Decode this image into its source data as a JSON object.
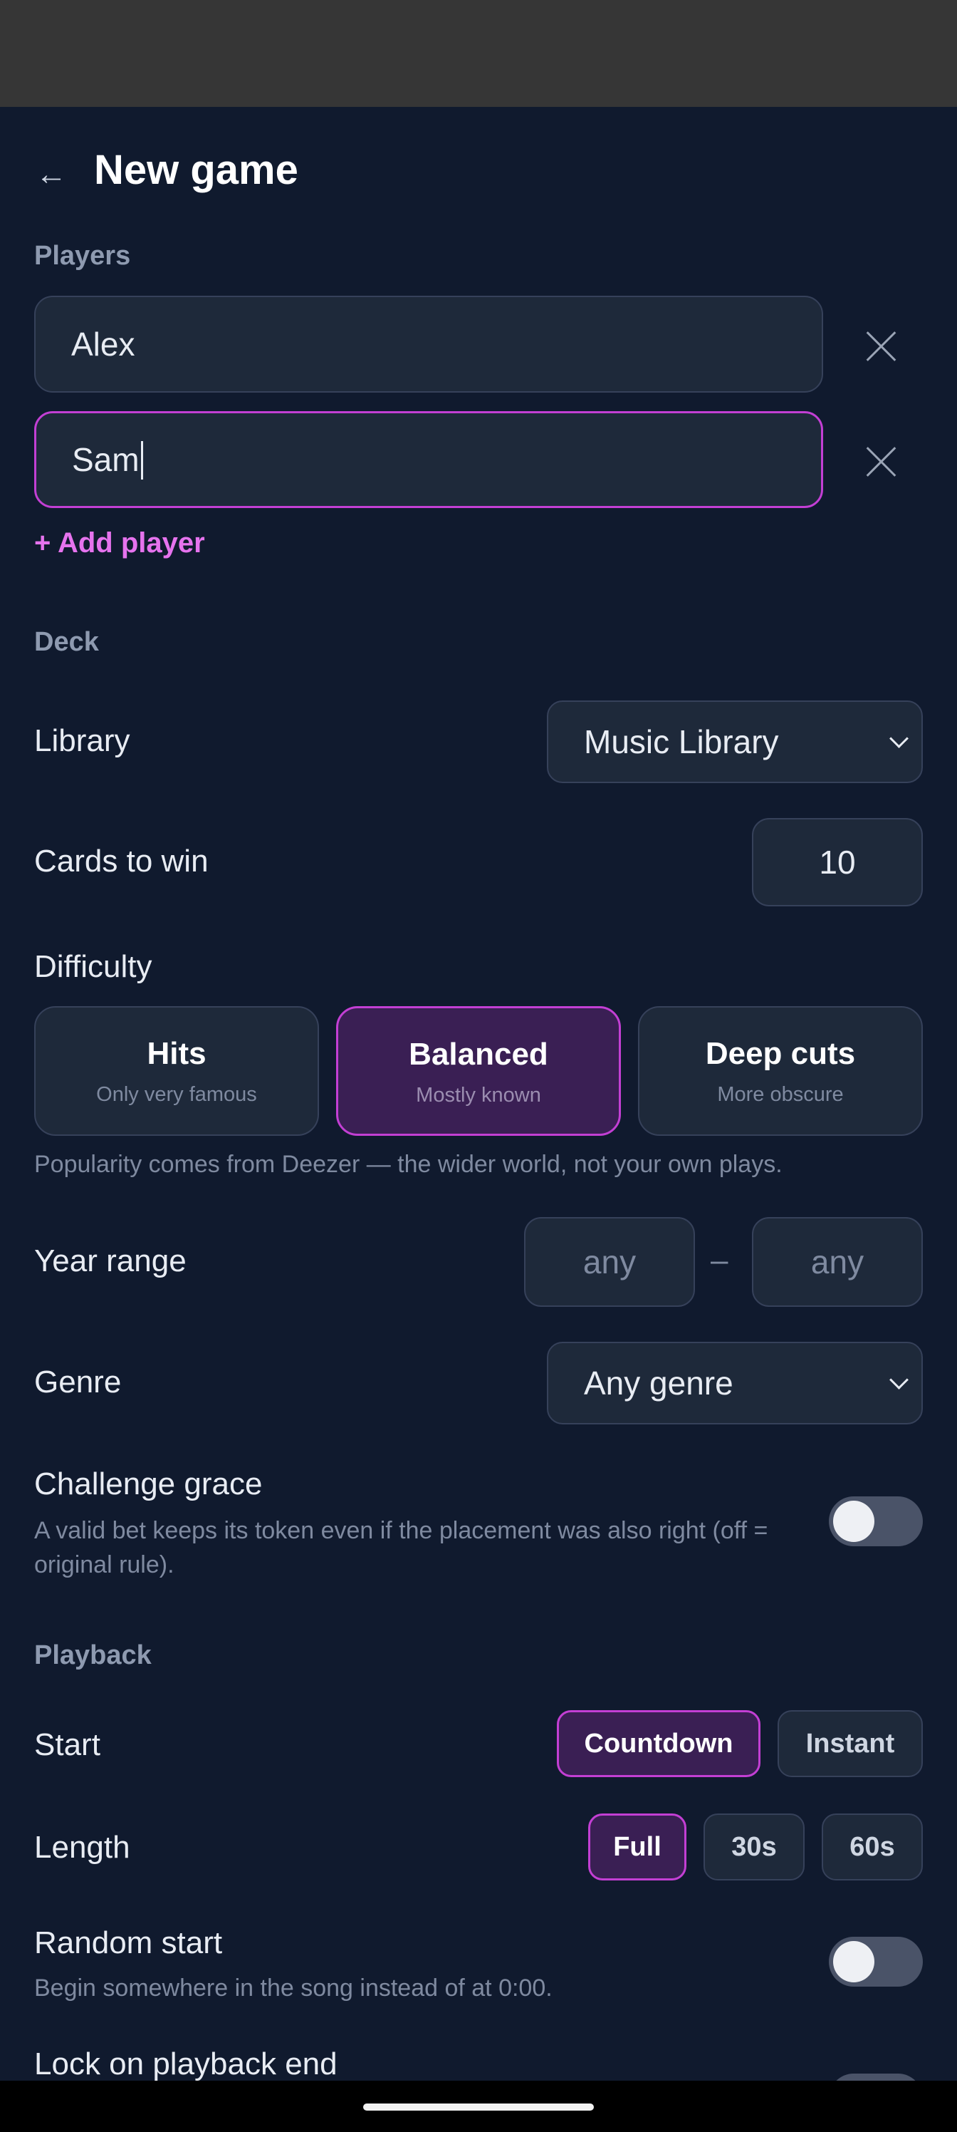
{
  "header": {
    "back_icon": "←",
    "title": "New game"
  },
  "players": {
    "section_label": "Players",
    "list": [
      {
        "name": "Alex",
        "focused": false
      },
      {
        "name": "Sam",
        "focused": true
      }
    ],
    "add_label": "+ Add player"
  },
  "deck": {
    "section_label": "Deck",
    "library": {
      "label": "Library",
      "value": "Music Library"
    },
    "cards_to_win": {
      "label": "Cards to win",
      "value": "10"
    },
    "difficulty": {
      "label": "Difficulty",
      "selected": "Balanced",
      "options": [
        {
          "title": "Hits",
          "subtitle": "Only very famous"
        },
        {
          "title": "Balanced",
          "subtitle": "Mostly known"
        },
        {
          "title": "Deep cuts",
          "subtitle": "More obscure"
        }
      ],
      "note": "Popularity comes from Deezer — the wider world, not your own plays."
    },
    "year_range": {
      "label": "Year range",
      "from": "any",
      "separator": "–",
      "to": "any"
    },
    "genre": {
      "label": "Genre",
      "value": "Any genre"
    },
    "challenge_grace": {
      "label": "Challenge grace",
      "description": "A valid bet keeps its token even if the placement was also right (off = original rule).",
      "enabled": false
    }
  },
  "playback": {
    "section_label": "Playback",
    "start": {
      "label": "Start",
      "options": [
        "Countdown",
        "Instant"
      ],
      "selected": "Countdown"
    },
    "length": {
      "label": "Length",
      "options": [
        "Full",
        "30s",
        "60s"
      ],
      "selected": "Full"
    },
    "random_start": {
      "label": "Random start",
      "description": "Begin somewhere in the song instead of at 0:00.",
      "enabled": false
    },
    "lock_on_end": {
      "label": "Lock on playback end"
    }
  },
  "colors": {
    "background": "#101a2e",
    "surface": "#1e293a",
    "accent": "#c33fd4",
    "accent_text": "#e673ee",
    "selected_fill": "#3a1f54"
  }
}
